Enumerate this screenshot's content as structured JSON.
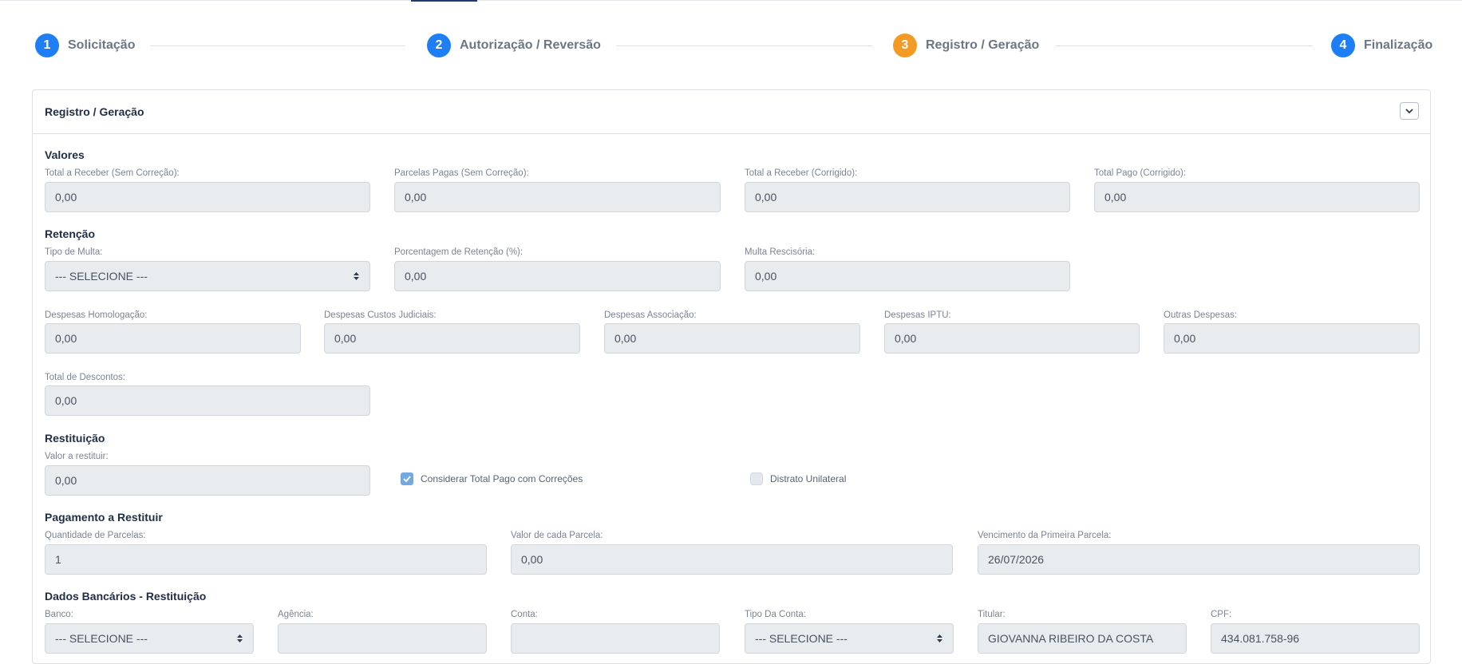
{
  "steps": [
    {
      "number": "1",
      "label": "Solicitação",
      "color": "#1e7ef5"
    },
    {
      "number": "2",
      "label": "Autorização / Reversão",
      "color": "#1e7ef5"
    },
    {
      "number": "3",
      "label": "Registro / Geração",
      "color": "#f29a24"
    },
    {
      "number": "4",
      "label": "Finalização",
      "color": "#1e7ef5"
    }
  ],
  "card": {
    "title": "Registro / Geração"
  },
  "valores": {
    "title": "Valores",
    "total_receber_sem": {
      "label": "Total a Receber (Sem Correção):",
      "value": "0,00"
    },
    "parcelas_pagas_sem": {
      "label": "Parcelas Pagas (Sem Correção):",
      "value": "0,00"
    },
    "total_receber_corr": {
      "label": "Total a Receber (Corrigido):",
      "value": "0,00"
    },
    "total_pago_corr": {
      "label": "Total Pago (Corrigido):",
      "value": "0,00"
    }
  },
  "retencao": {
    "title": "Retenção",
    "tipo_multa": {
      "label": "Tipo de Multa:",
      "value": "--- SELECIONE ---"
    },
    "porcentagem": {
      "label": "Porcentagem de Retenção (%):",
      "value": "0,00"
    },
    "multa_rescisoria": {
      "label": "Multa Rescisória:",
      "value": "0,00"
    },
    "despesas_homologacao": {
      "label": "Despesas Homologação:",
      "value": "0,00"
    },
    "despesas_custos": {
      "label": "Despesas Custos Judiciais:",
      "value": "0,00"
    },
    "despesas_associacao": {
      "label": "Despesas Associação:",
      "value": "0,00"
    },
    "despesas_iptu": {
      "label": "Despesas IPTU:",
      "value": "0,00"
    },
    "outras_despesas": {
      "label": "Outras Despesas:",
      "value": "0,00"
    },
    "total_descontos": {
      "label": "Total de Descontos:",
      "value": "0,00"
    }
  },
  "restituicao": {
    "title": "Restituição",
    "valor": {
      "label": "Valor a restituir:",
      "value": "0,00"
    },
    "considerar_label": "Considerar Total Pago com Correções",
    "considerar_checked": true,
    "distrato_label": "Distrato Unilateral",
    "distrato_checked": false
  },
  "pagamento": {
    "title": "Pagamento a Restituir",
    "quantidade": {
      "label": "Quantidade de Parcelas:",
      "value": "1"
    },
    "valor_parcela": {
      "label": "Valor de cada Parcela:",
      "value": "0,00"
    },
    "vencimento": {
      "label": "Vencimento da Primeira Parcela:",
      "value": "26/07/2026"
    }
  },
  "bancarios": {
    "title": "Dados Bancários - Restituição",
    "banco": {
      "label": "Banco:",
      "value": "--- SELECIONE ---"
    },
    "agencia": {
      "label": "Agência:",
      "value": ""
    },
    "conta": {
      "label": "Conta:",
      "value": ""
    },
    "tipo_conta": {
      "label": "Tipo Da Conta:",
      "value": "--- SELECIONE ---"
    },
    "titular": {
      "label": "Titular:",
      "value": "GIOVANNA RIBEIRO DA COSTA"
    },
    "cpf": {
      "label": "CPF:",
      "value": "434.081.758-96"
    }
  }
}
